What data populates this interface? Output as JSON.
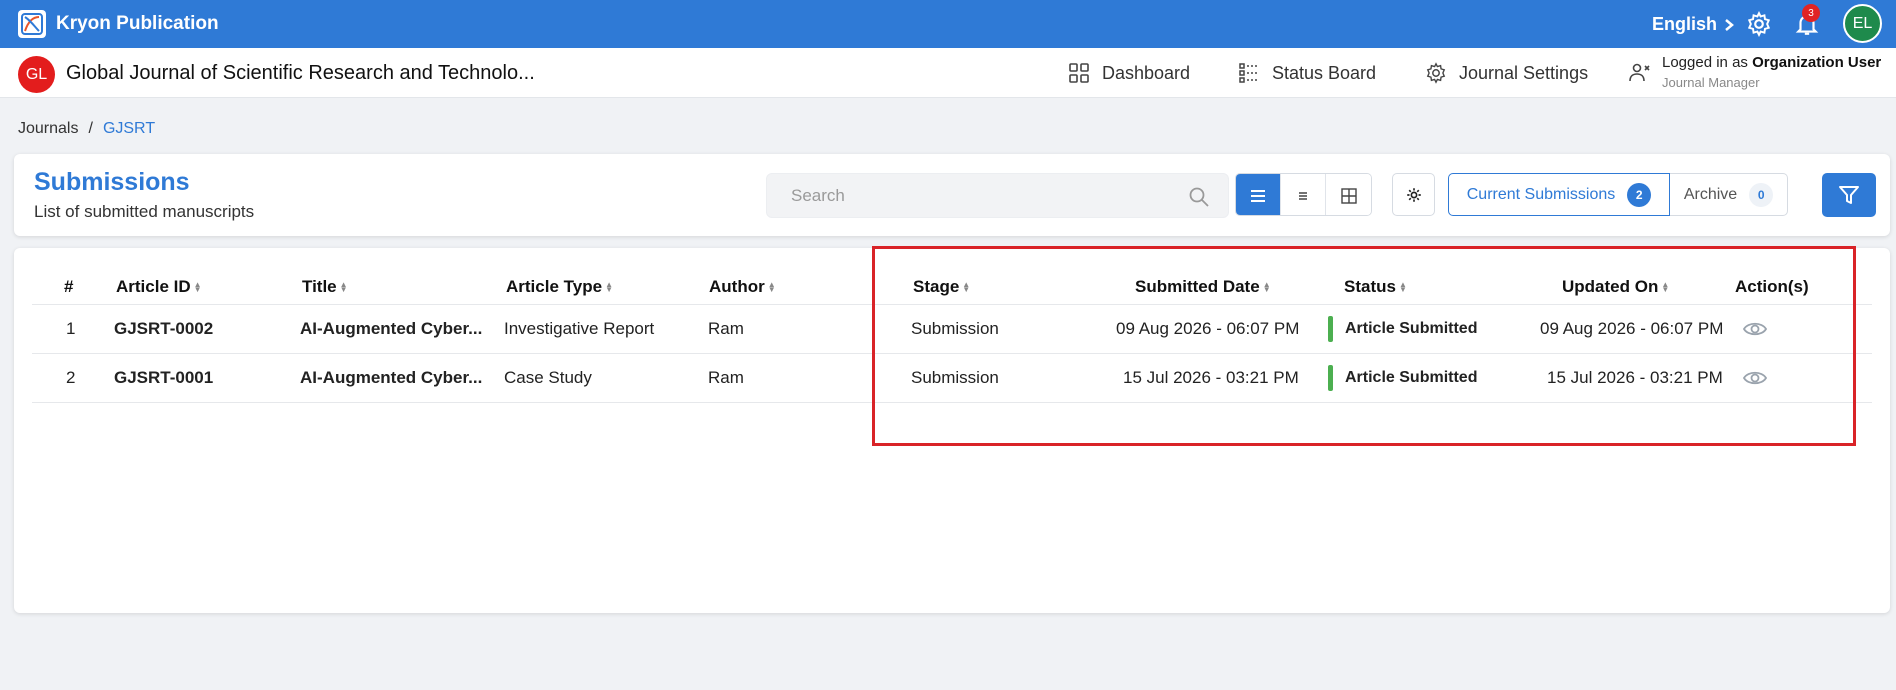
{
  "app": {
    "title": "Kryon Publication",
    "language": "English",
    "notifications_count": "3",
    "user_initials": "EL"
  },
  "journal": {
    "badge": "GL",
    "title": "Global Journal of Scientific Research and Technolo..."
  },
  "nav": {
    "dashboard": "Dashboard",
    "status_board": "Status Board",
    "journal_settings": "Journal Settings"
  },
  "user": {
    "logged_in_prefix": "Logged in as",
    "name": "Organization User",
    "role": "Journal Manager"
  },
  "breadcrumb": {
    "root": "Journals",
    "separator": "/",
    "current": "GJSRT"
  },
  "page": {
    "title": "Submissions",
    "subtitle": "List of submitted manuscripts"
  },
  "search": {
    "placeholder": "Search",
    "value": ""
  },
  "tabs": {
    "current_label": "Current Submissions",
    "current_count": "2",
    "archive_label": "Archive",
    "archive_count": "0"
  },
  "table": {
    "headers": {
      "num": "#",
      "article_id": "Article ID",
      "title": "Title",
      "article_type": "Article Type",
      "author": "Author",
      "stage": "Stage",
      "submitted_date": "Submitted Date",
      "status": "Status",
      "updated_on": "Updated On",
      "actions": "Action(s)"
    },
    "rows": [
      {
        "num": "1",
        "article_id": "GJSRT-0002",
        "title": "AI-Augmented Cyber...",
        "article_type": "Investigative Report",
        "author": "Ram",
        "stage": "Submission",
        "submitted_date": "09 Aug 2026 - 06:07 PM",
        "status": "Article Submitted",
        "updated_on": "09 Aug 2026 - 06:07 PM"
      },
      {
        "num": "2",
        "article_id": "GJSRT-0001",
        "title": "AI-Augmented Cyber...",
        "article_type": "Case Study",
        "author": "Ram",
        "stage": "Submission",
        "submitted_date": "15 Jul 2026 - 03:21 PM",
        "status": "Article Submitted",
        "updated_on": "15 Jul 2026 - 03:21 PM"
      }
    ]
  },
  "colors": {
    "primary": "#2f7ad6",
    "status_green": "#4caf50",
    "highlight": "#d92328",
    "journal_badge": "#e31d1d",
    "avatar": "#1e8a4c"
  },
  "icons": [
    "app-logo-icon",
    "chevron-right-icon",
    "gear-icon",
    "bell-icon",
    "dashboard-icon",
    "status-board-icon",
    "journal-settings-icon",
    "users-icon",
    "search-icon",
    "list-view-icon",
    "compact-list-icon",
    "grid-view-icon",
    "settings-icon",
    "filter-icon",
    "sort-icon",
    "eye-icon"
  ]
}
